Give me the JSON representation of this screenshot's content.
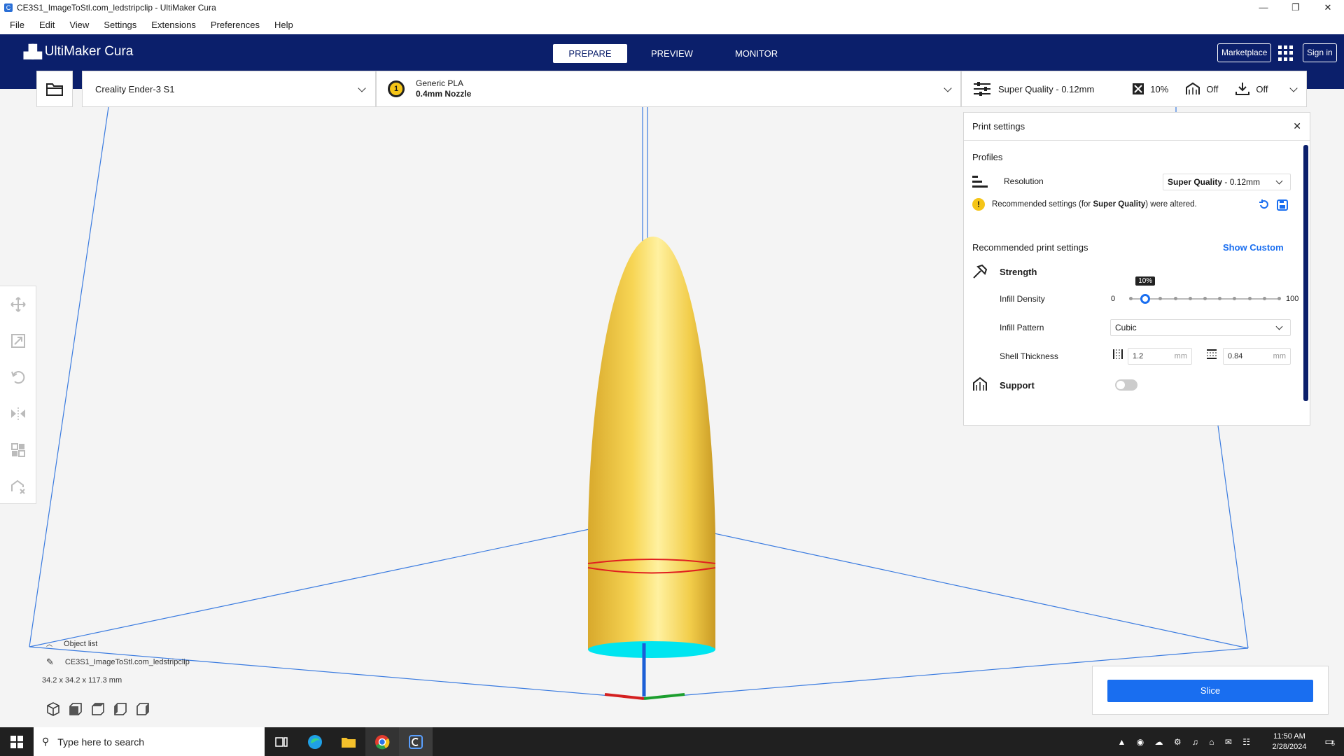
{
  "window": {
    "title": "CE3S1_ImageToStl.com_ledstripclip - UltiMaker Cura",
    "minimize": "—",
    "maximize": "❐",
    "close": "✕"
  },
  "menu": [
    "File",
    "Edit",
    "View",
    "Settings",
    "Extensions",
    "Preferences",
    "Help"
  ],
  "header": {
    "brand": "UltiMaker Cura",
    "stages": [
      "PREPARE",
      "PREVIEW",
      "MONITOR"
    ],
    "active_stage": "PREPARE",
    "marketplace": "Marketplace",
    "signin": "Sign in"
  },
  "machine": {
    "printer": "Creality Ender-3 S1",
    "extruder_index": "1",
    "material": "Generic PLA",
    "nozzle": "0.4mm Nozzle"
  },
  "settings_summary": {
    "profile": "Super Quality - 0.12mm",
    "infill": "10%",
    "support": "Off",
    "adhesion": "Off"
  },
  "print_settings": {
    "title": "Print settings",
    "profiles_label": "Profiles",
    "resolution_label": "Resolution",
    "resolution_value_bold": "Super Quality",
    "resolution_value_rest": " - 0.12mm",
    "altered_prefix": "Recommended settings (for ",
    "altered_bold": "Super Quality",
    "altered_suffix": ") were altered.",
    "recommended_label": "Recommended print settings",
    "show_custom": "Show Custom",
    "strength_label": "Strength",
    "infill_density_label": "Infill Density",
    "infill_min": "0",
    "infill_max": "100",
    "infill_tooltip": "10%",
    "infill_density_value": 10,
    "infill_pattern_label": "Infill Pattern",
    "infill_pattern_value": "Cubic",
    "shell_thickness_label": "Shell Thickness",
    "wall_thickness": "1.2",
    "top_bottom_thickness": "0.84",
    "unit": "mm",
    "support_label": "Support",
    "support_enabled": false
  },
  "object_list": {
    "label": "Object list",
    "object_name": "CE3S1_ImageToStl.com_ledstripclip",
    "dimensions": "34.2 x 34.2 x 117.3 mm"
  },
  "slice": {
    "label": "Slice"
  },
  "taskbar": {
    "search_placeholder": "Type here to search",
    "time": "11:50 AM",
    "date": "2/28/2024",
    "notification_count": "5"
  },
  "colors": {
    "header_bg": "#0b1f6b",
    "accent": "#196ef0",
    "model_yellow": "#f7d554",
    "build_plate_line": "#3a7be0",
    "model_bottom": "#00e5f0"
  }
}
